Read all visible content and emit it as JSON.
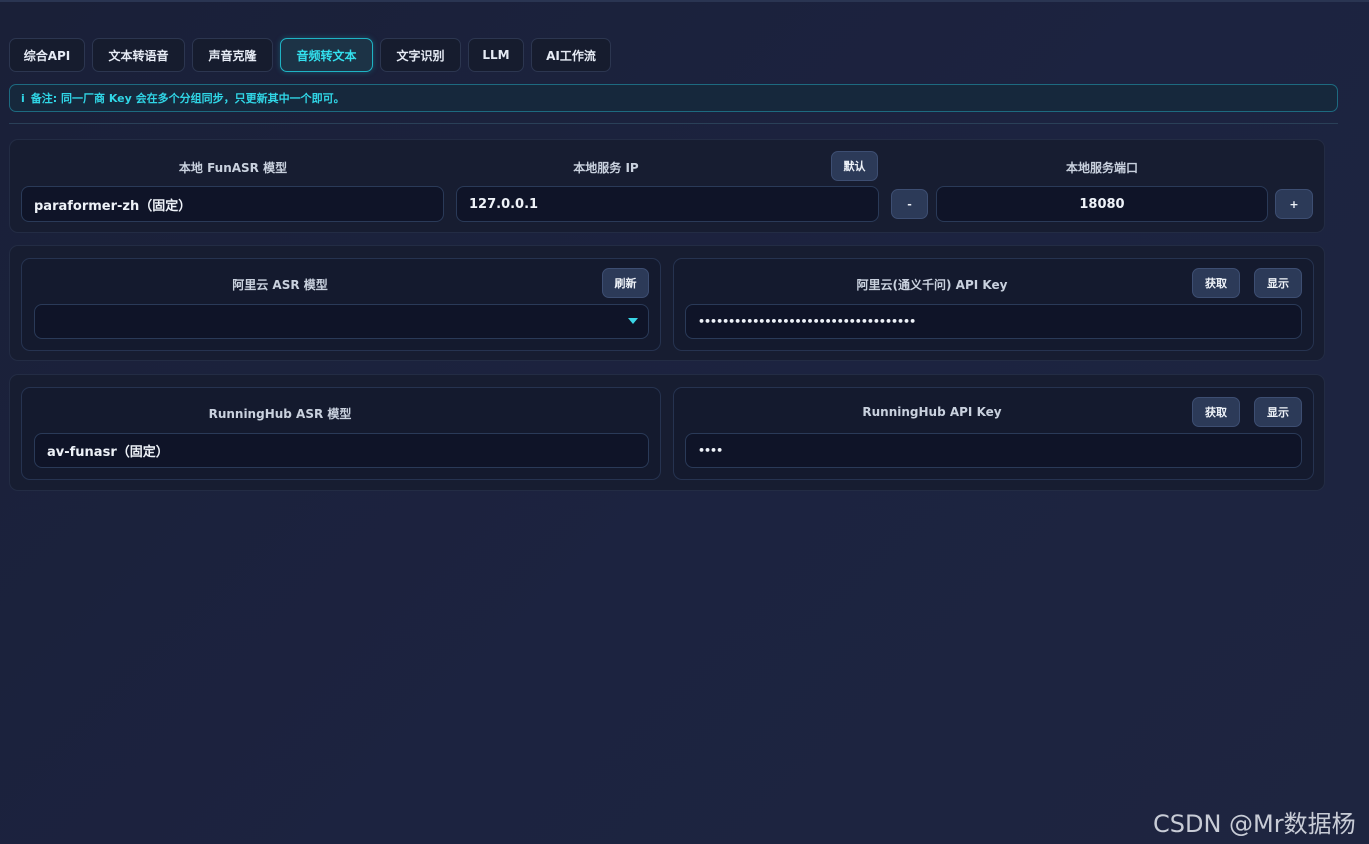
{
  "tabs": [
    {
      "label": "综合API"
    },
    {
      "label": "文本转语音"
    },
    {
      "label": "声音克隆"
    },
    {
      "label": "音频转文本"
    },
    {
      "label": "文字识别"
    },
    {
      "label": "LLM"
    },
    {
      "label": "AI工作流"
    }
  ],
  "active_tab": "音频转文本",
  "note": {
    "icon": "i",
    "text": "备注: 同一厂商 Key 会在多个分组同步，只更新其中一个即可。"
  },
  "local": {
    "model_label": "本地 FunASR 模型",
    "model_value": "paraformer-zh（固定）",
    "ip_label": "本地服务 IP",
    "default_button": "默认",
    "ip_value": "127.0.0.1",
    "port_label": "本地服务端口",
    "port_value": "18080",
    "decrement": "-",
    "increment": "+"
  },
  "aliyun": {
    "model_label": "阿里云 ASR 模型",
    "refresh_button": "刷新",
    "model_value": "",
    "key_label": "阿里云(通义千问) API Key",
    "get_button": "获取",
    "show_button": "显示",
    "key_value": "••••••••••••••••••••••••••••••••••••"
  },
  "runninghub": {
    "model_label": "RunningHub ASR 模型",
    "model_value": "av-funasr（固定）",
    "key_label": "RunningHub API Key",
    "get_button": "获取",
    "show_button": "显示",
    "key_value": "••••"
  },
  "watermark": "CSDN @Mr数据杨",
  "colors": {
    "accent": "#33e0ee",
    "background": "#1b2139",
    "panel": "#171d31",
    "button": "#2c3a58"
  }
}
